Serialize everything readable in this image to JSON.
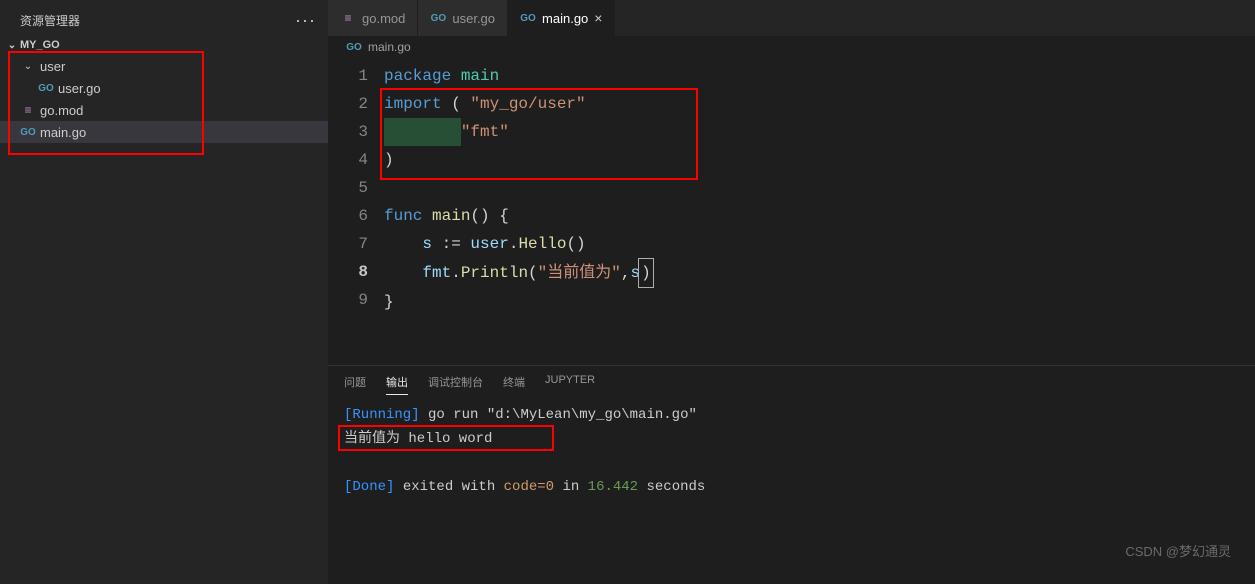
{
  "sidebar": {
    "title": "资源管理器",
    "project": "MY_GO",
    "items": [
      {
        "label": "user",
        "type": "folder"
      },
      {
        "label": "user.go",
        "type": "go"
      },
      {
        "label": "go.mod",
        "type": "mod"
      },
      {
        "label": "main.go",
        "type": "go"
      }
    ]
  },
  "tabs": [
    {
      "label": "go.mod",
      "icon": "mod",
      "active": false
    },
    {
      "label": "user.go",
      "icon": "go",
      "active": false
    },
    {
      "label": "main.go",
      "icon": "go",
      "active": true
    }
  ],
  "breadcrumb": "main.go",
  "code": {
    "lines": [
      "1",
      "2",
      "3",
      "4",
      "5",
      "6",
      "7",
      "8",
      "9"
    ],
    "l1_kw": "package",
    "l1_pkg": " main",
    "l2_kw": "import",
    "l2_paren": " (",
    "l2_str": " \"my_go/user\"",
    "l3_str": "\"fmt\"",
    "l4_paren": ")",
    "l6_kw": "func",
    "l6_fn": " main",
    "l6_rest": "() {",
    "l7_s": "    s ",
    "l7_assign": ":= ",
    "l7_user": "user",
    "l7_dot": ".",
    "l7_hello": "Hello",
    "l7_end": "()",
    "l8_indent": "    ",
    "l8_fmt": "fmt",
    "l8_dot": ".",
    "l8_println": "Println",
    "l8_open": "(",
    "l8_str": "\"当前值为\"",
    "l8_comma": ",",
    "l8_s": "s",
    "l8_close": ")",
    "l9": "}"
  },
  "panel": {
    "tabs": [
      "问题",
      "输出",
      "调试控制台",
      "终端",
      "JUPYTER"
    ],
    "active_tab": 1,
    "running_label": "[Running]",
    "running_cmd": " go run \"d:\\MyLean\\my_go\\main.go\"",
    "output_line": "当前值为 hello word",
    "done_label": "[Done]",
    "done_text1": " exited with ",
    "done_code": "code=0",
    "done_text2": " in ",
    "done_time": "16.442",
    "done_text3": " seconds"
  },
  "watermark": "CSDN @梦幻通灵"
}
